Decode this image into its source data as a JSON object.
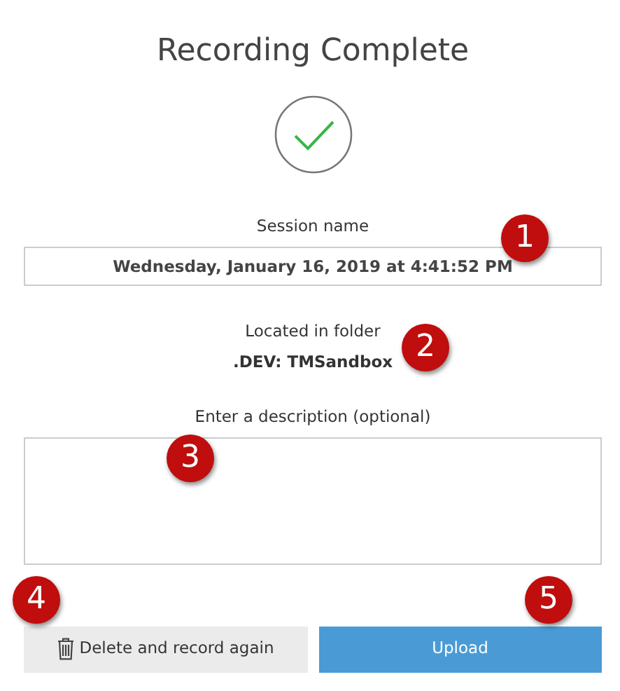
{
  "title": "Recording Complete",
  "session": {
    "label": "Session name",
    "value": "Wednesday, January 16, 2019 at 4:41:52 PM"
  },
  "folder": {
    "label": "Located in folder",
    "value": ".DEV: TMSandbox"
  },
  "description": {
    "label": "Enter a description (optional)"
  },
  "buttons": [
    {
      "kind": "secondary",
      "label": "Delete and record again"
    },
    {
      "kind": "primary",
      "label": "Upload"
    }
  ],
  "callouts": [
    {
      "label": "1"
    },
    {
      "label": "2"
    },
    {
      "label": "3"
    },
    {
      "label": "4"
    },
    {
      "label": "5"
    }
  ]
}
